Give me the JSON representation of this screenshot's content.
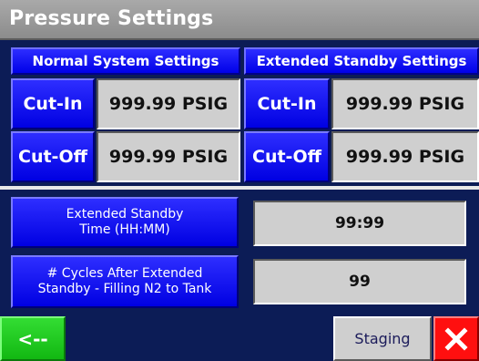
{
  "window": {
    "title": "Pressure Settings"
  },
  "normal": {
    "header": "Normal System Settings",
    "cut_in_label": "Cut-In",
    "cut_in_value": "999.99 PSIG",
    "cut_off_label": "Cut-Off",
    "cut_off_value": "999.99 PSIG"
  },
  "extended": {
    "header": "Extended Standby Settings",
    "cut_in_label": "Cut-In",
    "cut_in_value": "999.99 PSIG",
    "cut_off_label": "Cut-Off",
    "cut_off_value": "999.99 PSIG"
  },
  "standby_time": {
    "label_line1": "Extended Standby",
    "label_line2": "Time (HH:MM)",
    "value": "99:99"
  },
  "cycles": {
    "label_line1": "# Cycles After Extended",
    "label_line2": "Standby - Filling N2 to Tank",
    "value": "99"
  },
  "footer": {
    "back_label": "<--",
    "staging_label": "Staging",
    "close_icon": "close-x-icon"
  },
  "colors": {
    "background": "#0c1c56",
    "button_blue": "#0000e8",
    "field_gray": "#cfcfcf",
    "back_green": "#22cc22",
    "close_red": "#ff0f0f"
  }
}
